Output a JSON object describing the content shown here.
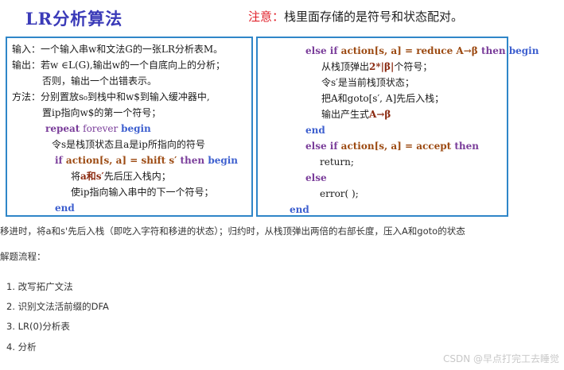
{
  "slide": {
    "title": "LR分析算法",
    "note_label": "注意：",
    "note_text": "栈里面存储的是符号和状态配对。"
  },
  "left_box": {
    "line1": "输入：一个输入串w和文法G的一张LR分析表M。",
    "line2": "输出：若w ∈L(G),输出w的一个自底向上的分析；",
    "line3": "否则，输出一个出错表示。",
    "line4": "方法：分别置放s₀到栈中和w$到输入缓冲器中,",
    "line5": "置ip指向w$的第一个符号；",
    "repeat_kw": "repeat",
    "forever_kw": " forever ",
    "begin_kw": "begin",
    "line7": "令s是栈顶状态且a是ip所指向的符号",
    "if_kw": "if",
    "cond": " action[s, a] = shift s′",
    "then_kw": " then ",
    "begin2_kw": "begin",
    "line9_a": "将",
    "line9_b": "a和s′",
    "line9_c": "先后压入栈内；",
    "line10": "使ip指向输入串中的下一个符号；",
    "end_kw": "end"
  },
  "right_box": {
    "elseif_kw": "else if",
    "cond1": " action[s, a] = reduce A",
    "beta1": "β",
    "then_kw": " then ",
    "begin_kw": "begin",
    "line2_a": "从栈顶弹出",
    "line2_b": "2*|β|",
    "line2_c": "个符号；",
    "line3": "令s′是当前栈顶状态；",
    "line4": "把A和goto[s′, A]先后入栈；",
    "line5_a": "输出产生式",
    "line5_b": "A",
    "line5_c": "β",
    "end1_kw": "end",
    "elseif2_kw": "else if",
    "cond2": " action[s, a] = accept",
    "then2_kw": " then",
    "return_text": "return;",
    "else_kw": "else",
    "error_text": "error( );",
    "end2_kw": "end"
  },
  "body_text": {
    "description": "移进时，将a和s'先后入栈（即吃入字符和移进的状态）；归约时，从栈顶弹出两倍的右部长度，压入A和goto的状态",
    "steps_heading": "解题流程：",
    "steps": [
      "1. 改写拓广文法",
      "2. 识别文法活前缀的DFA",
      "3. LR(0)分析表",
      "4. 分析"
    ]
  },
  "watermark": "CSDN @早点打完工去睡觉"
}
